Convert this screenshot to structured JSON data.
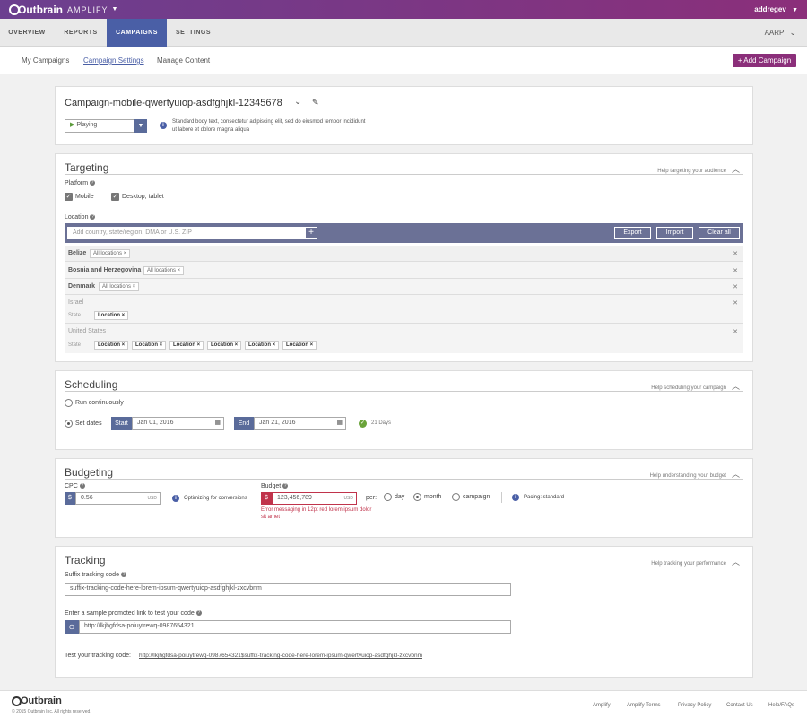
{
  "topbar": {
    "brand": "Outbrain",
    "product": "AMPLIFY",
    "user": "addregev"
  },
  "nav": {
    "tabs": [
      "OVERVIEW",
      "REPORTS",
      "CAMPAIGNS",
      "SETTINGS"
    ],
    "account": "AARP"
  },
  "subnav": {
    "items": [
      "My Campaigns",
      "Campaign Settings",
      "Manage Content"
    ],
    "add_button": "+ Add Campaign"
  },
  "campaign": {
    "name": "Campaign-mobile-qwertyuiop-asdfghjkl-12345678",
    "status": "Playing",
    "description_line1": "Standard body text, consectetur adipiscing elit, sed do eiusmod tempor incididunt",
    "description_line2": "ut labore et dolore magna aliqua"
  },
  "targeting": {
    "title": "Targeting",
    "help": "Help targeting your audience",
    "platform_label": "Platform",
    "mobile": "Mobile",
    "desktop": "Desktop, tablet",
    "location_label": "Location",
    "search_placeholder": "Add country, state/region, DMA or U.S. ZIP",
    "export": "Export",
    "import": "Import",
    "clear_all": "Clear all",
    "rows": [
      {
        "name": "Belize",
        "tag": "All locations"
      },
      {
        "name": "Bosnia and Herzegovina",
        "tag": "All locations"
      },
      {
        "name": "Denmark",
        "tag": "All locations"
      }
    ],
    "israel": "Israel",
    "us": "United States",
    "state_label": "State",
    "location_tag": "Location"
  },
  "scheduling": {
    "title": "Scheduling",
    "help": "Help scheduling your campaign",
    "run_continuously": "Run continuously",
    "set_dates": "Set dates",
    "start_label": "Start",
    "start_date": "Jan 01, 2016",
    "end_label": "End",
    "end_date": "Jan 21, 2016",
    "days": "21 Days"
  },
  "budgeting": {
    "title": "Budgeting",
    "help": "Help understanding your budget",
    "cpc_label": "CPC",
    "cpc_value": "0.56",
    "currency": "USD",
    "optimizing": "Optimizing for conversions",
    "budget_label": "Budget",
    "budget_value": "123,456,789",
    "error_line1": "Error messaging in 12pt red lorem ipsum dolor",
    "error_line2": "sit amet",
    "per": "per:",
    "day": "day",
    "month": "month",
    "campaign": "campaign",
    "pacing": "Pacing: standard",
    "dollar": "$"
  },
  "tracking": {
    "title": "Tracking",
    "help": "Help tracking your performance",
    "suffix_label": "Suffix tracking code",
    "suffix_value": "suffix-tracking-code-here-lorem-ipsum-qwertyuiop-asdfghjkl-zxcvbnm",
    "sample_label": "Enter a sample promoted link to test your code",
    "sample_value": "http://lkjhgfdsa-poiuytrewq-0987654321",
    "test_label": "Test your tracking code:",
    "test_link": "http://lkjhgfdsa-poiuytrewq-0987654321$suffix-tracking-code-here-lorem-ipsum-qwertyuiop-asdfghjkl-zxcvbnm"
  },
  "footer": {
    "copyright": "© 2015 Outbrain Inc. All rights reserved.",
    "links": [
      "Amplify",
      "Amplify Terms",
      "Privacy Policy",
      "Contact Us",
      "Help/FAQs"
    ]
  }
}
